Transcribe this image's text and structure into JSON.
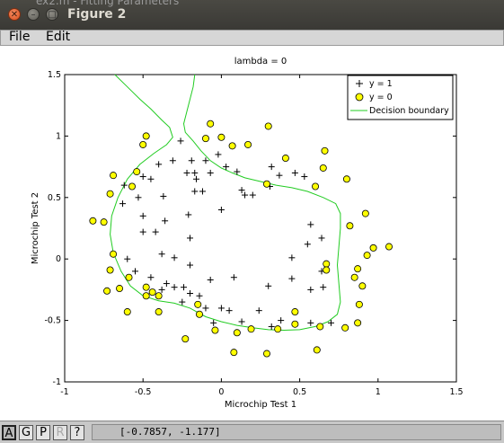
{
  "window": {
    "title": "Figure 2",
    "behind_title_text": "ex2.m - Fitting Parameters"
  },
  "menu": {
    "file": "File",
    "edit": "Edit"
  },
  "toolbar": {
    "buttons": [
      "A",
      "G",
      "P",
      "R",
      "?"
    ]
  },
  "status": {
    "coordinates": "[-0.7857, -1.177]"
  },
  "colors": {
    "accepted_marker": "#000000",
    "rejected_fill": "#ffff00",
    "boundary": "#22cc22"
  },
  "chart_data": {
    "type": "scatter",
    "title": "lambda = 0",
    "xlabel": "Microchip Test 1",
    "ylabel": "Microchip Test 2",
    "xlim": [
      -1,
      1.5
    ],
    "ylim": [
      -1,
      1.5
    ],
    "xticks": [
      "-1",
      "-0.5",
      "0",
      "0.5",
      "1",
      "1.5"
    ],
    "yticks": [
      "-1",
      "-0.5",
      "0",
      "0.5",
      "1",
      "1.5"
    ],
    "legend": {
      "placement": "top-right",
      "entries": [
        "y = 1",
        "y = 0",
        "Decision boundary"
      ]
    },
    "series": [
      {
        "name": "y = 1",
        "marker": "plus",
        "points": [
          [
            -0.26,
            0.96
          ],
          [
            -0.4,
            0.77
          ],
          [
            -0.31,
            0.8
          ],
          [
            -0.19,
            0.8
          ],
          [
            -0.1,
            0.8
          ],
          [
            -0.22,
            0.7
          ],
          [
            -0.17,
            0.7
          ],
          [
            -0.16,
            0.65
          ],
          [
            -0.02,
            0.85
          ],
          [
            -0.5,
            0.67
          ],
          [
            -0.45,
            0.65
          ],
          [
            -0.62,
            0.6
          ],
          [
            -0.53,
            0.5
          ],
          [
            -0.37,
            0.51
          ],
          [
            -0.17,
            0.55
          ],
          [
            -0.12,
            0.55
          ],
          [
            0.03,
            0.75
          ],
          [
            -0.07,
            0.7
          ],
          [
            0.1,
            0.71
          ],
          [
            0.13,
            0.56
          ],
          [
            0.15,
            0.52
          ],
          [
            0.2,
            0.52
          ],
          [
            0.32,
            0.75
          ],
          [
            0.37,
            0.68
          ],
          [
            0.47,
            0.7
          ],
          [
            0.31,
            0.59
          ],
          [
            0.53,
            0.67
          ],
          [
            -0.63,
            0.45
          ],
          [
            -0.5,
            0.35
          ],
          [
            -0.36,
            0.31
          ],
          [
            -0.21,
            0.36
          ],
          [
            0.0,
            0.4
          ],
          [
            -0.5,
            0.22
          ],
          [
            -0.42,
            0.22
          ],
          [
            -0.2,
            0.17
          ],
          [
            0.57,
            0.28
          ],
          [
            0.55,
            0.12
          ],
          [
            0.64,
            0.17
          ],
          [
            -0.6,
            0.0
          ],
          [
            -0.38,
            0.04
          ],
          [
            -0.3,
            0.01
          ],
          [
            -0.2,
            -0.05
          ],
          [
            0.45,
            0.01
          ],
          [
            -0.55,
            -0.1
          ],
          [
            -0.45,
            -0.15
          ],
          [
            -0.38,
            -0.25
          ],
          [
            -0.35,
            -0.2
          ],
          [
            -0.3,
            -0.23
          ],
          [
            -0.24,
            -0.23
          ],
          [
            -0.25,
            -0.35
          ],
          [
            -0.2,
            -0.28
          ],
          [
            -0.14,
            -0.3
          ],
          [
            -0.07,
            -0.17
          ],
          [
            0.08,
            -0.15
          ],
          [
            0.3,
            -0.22
          ],
          [
            0.45,
            -0.16
          ],
          [
            0.57,
            -0.25
          ],
          [
            0.64,
            -0.1
          ],
          [
            0.65,
            -0.23
          ],
          [
            0.0,
            -0.4
          ],
          [
            -0.1,
            -0.4
          ],
          [
            0.05,
            -0.42
          ],
          [
            0.24,
            -0.42
          ],
          [
            0.38,
            -0.5
          ],
          [
            0.57,
            -0.52
          ],
          [
            0.7,
            -0.52
          ],
          [
            -0.05,
            -0.52
          ],
          [
            0.13,
            -0.51
          ],
          [
            0.32,
            -0.55
          ]
        ]
      },
      {
        "name": "y = 0",
        "marker": "circle",
        "points": [
          [
            -0.07,
            1.1
          ],
          [
            0.3,
            1.08
          ],
          [
            -0.48,
            1.0
          ],
          [
            -0.1,
            0.98
          ],
          [
            0.0,
            0.99
          ],
          [
            -0.5,
            0.93
          ],
          [
            0.07,
            0.92
          ],
          [
            0.17,
            0.93
          ],
          [
            0.41,
            0.82
          ],
          [
            0.66,
            0.88
          ],
          [
            -0.69,
            0.68
          ],
          [
            -0.54,
            0.71
          ],
          [
            0.65,
            0.74
          ],
          [
            0.8,
            0.65
          ],
          [
            -0.57,
            0.59
          ],
          [
            -0.71,
            0.53
          ],
          [
            0.29,
            0.61
          ],
          [
            0.6,
            0.59
          ],
          [
            -0.82,
            0.31
          ],
          [
            -0.75,
            0.3
          ],
          [
            0.92,
            0.37
          ],
          [
            0.82,
            0.27
          ],
          [
            0.97,
            0.09
          ],
          [
            1.07,
            0.1
          ],
          [
            -0.69,
            0.04
          ],
          [
            0.93,
            0.03
          ],
          [
            0.67,
            -0.04
          ],
          [
            -0.71,
            -0.09
          ],
          [
            0.87,
            -0.08
          ],
          [
            0.67,
            -0.09
          ],
          [
            -0.59,
            -0.15
          ],
          [
            0.85,
            -0.15
          ],
          [
            -0.65,
            -0.24
          ],
          [
            -0.73,
            -0.26
          ],
          [
            -0.48,
            -0.23
          ],
          [
            -0.44,
            -0.27
          ],
          [
            0.9,
            -0.22
          ],
          [
            -0.48,
            -0.3
          ],
          [
            -0.4,
            -0.3
          ],
          [
            -0.6,
            -0.43
          ],
          [
            -0.4,
            -0.43
          ],
          [
            -0.15,
            -0.37
          ],
          [
            0.88,
            -0.37
          ],
          [
            -0.14,
            -0.45
          ],
          [
            0.47,
            -0.43
          ],
          [
            0.47,
            -0.53
          ],
          [
            0.63,
            -0.55
          ],
          [
            0.87,
            -0.52
          ],
          [
            0.79,
            -0.56
          ],
          [
            -0.23,
            -0.65
          ],
          [
            -0.04,
            -0.58
          ],
          [
            0.1,
            -0.6
          ],
          [
            0.19,
            -0.57
          ],
          [
            0.36,
            -0.57
          ],
          [
            0.08,
            -0.76
          ],
          [
            0.29,
            -0.77
          ],
          [
            0.61,
            -0.74
          ]
        ]
      }
    ],
    "decision_boundary": [
      [
        -0.68,
        1.5
      ],
      [
        -0.6,
        1.4
      ],
      [
        -0.52,
        1.3
      ],
      [
        -0.45,
        1.22
      ],
      [
        -0.38,
        1.13
      ],
      [
        -0.33,
        1.07
      ],
      [
        -0.31,
        0.99
      ],
      [
        -0.35,
        0.93
      ],
      [
        -0.43,
        0.86
      ],
      [
        -0.52,
        0.77
      ],
      [
        -0.6,
        0.65
      ],
      [
        -0.66,
        0.5
      ],
      [
        -0.7,
        0.35
      ],
      [
        -0.71,
        0.2
      ],
      [
        -0.69,
        0.05
      ],
      [
        -0.64,
        -0.1
      ],
      [
        -0.58,
        -0.22
      ],
      [
        -0.5,
        -0.3
      ],
      [
        -0.4,
        -0.34
      ],
      [
        -0.3,
        -0.36
      ],
      [
        -0.2,
        -0.4
      ],
      [
        -0.1,
        -0.47
      ],
      [
        0.0,
        -0.51
      ],
      [
        0.1,
        -0.54
      ],
      [
        0.2,
        -0.56
      ],
      [
        0.3,
        -0.575
      ],
      [
        0.4,
        -0.58
      ],
      [
        0.5,
        -0.575
      ],
      [
        0.6,
        -0.55
      ],
      [
        0.68,
        -0.51
      ],
      [
        0.74,
        -0.45
      ],
      [
        0.76,
        -0.35
      ],
      [
        0.75,
        -0.2
      ],
      [
        0.74,
        -0.05
      ],
      [
        0.75,
        0.1
      ],
      [
        0.76,
        0.25
      ],
      [
        0.76,
        0.37
      ],
      [
        0.73,
        0.45
      ],
      [
        0.65,
        0.5
      ],
      [
        0.55,
        0.55
      ],
      [
        0.45,
        0.58
      ],
      [
        0.35,
        0.6
      ],
      [
        0.25,
        0.63
      ],
      [
        0.15,
        0.66
      ],
      [
        0.07,
        0.7
      ],
      [
        0.0,
        0.74
      ],
      [
        -0.07,
        0.8
      ],
      [
        -0.13,
        0.88
      ],
      [
        -0.18,
        0.96
      ],
      [
        -0.23,
        1.03
      ],
      [
        -0.24,
        1.1
      ],
      [
        -0.22,
        1.2
      ],
      [
        -0.2,
        1.3
      ],
      [
        -0.18,
        1.4
      ],
      [
        -0.17,
        1.5
      ]
    ]
  }
}
